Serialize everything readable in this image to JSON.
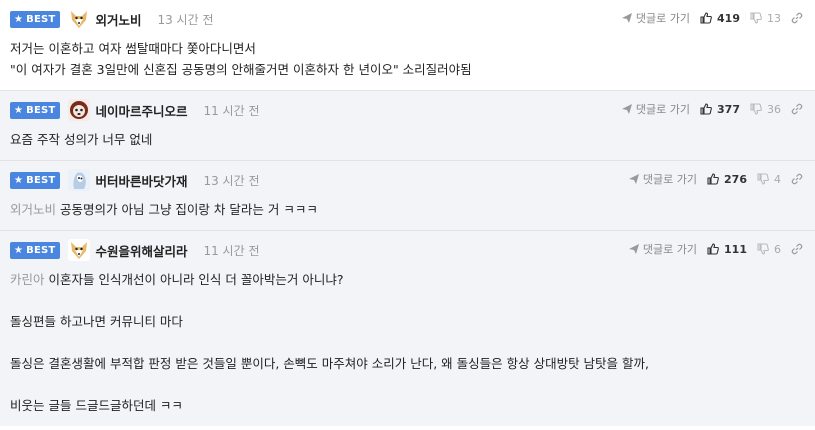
{
  "best_label": "BEST",
  "reply_label": "댓글로 가기",
  "comments": [
    {
      "nick": "외거노비",
      "time": "13 시간 전",
      "up": "419",
      "down": "13",
      "mention": "",
      "lines": [
        "저거는 이혼하고 여자 썸탈때마다 쫓아다니면서",
        "\"이 여자가 결혼 3일만에 신혼집 공동명의 안해줄거면 이혼하자 한 년이오\" 소리질러야됨"
      ]
    },
    {
      "nick": "네이마르주니오르",
      "time": "11 시간 전",
      "up": "377",
      "down": "36",
      "mention": "",
      "lines": [
        "요즘 주작 성의가 너무 없네"
      ]
    },
    {
      "nick": "버터바른바닷가재",
      "time": "13 시간 전",
      "up": "276",
      "down": "4",
      "mention": "외거노비",
      "lines": [
        "공동명의가 아님 그냥 집이랑 차 달라는 거 ㅋㅋㅋ"
      ]
    },
    {
      "nick": "수원을위해살리라",
      "time": "11 시간 전",
      "up": "111",
      "down": "6",
      "mention": "카린아",
      "lines": [
        "이혼자들 인식개선이 아니라 인식 더 꼴아박는거 아니냐?",
        "",
        "돌싱편들 하고나면 커뮤니티 마다",
        "",
        "돌싱은 결혼생활에 부적합 판정 받은 것들일 뿐이다, 손뼉도 마주쳐야 소리가 난다, 왜 돌싱들은 항상 상대방탓 남탓을 할까,",
        "",
        "비웃는 글들 드글드글하던데 ㅋㅋ"
      ]
    }
  ]
}
